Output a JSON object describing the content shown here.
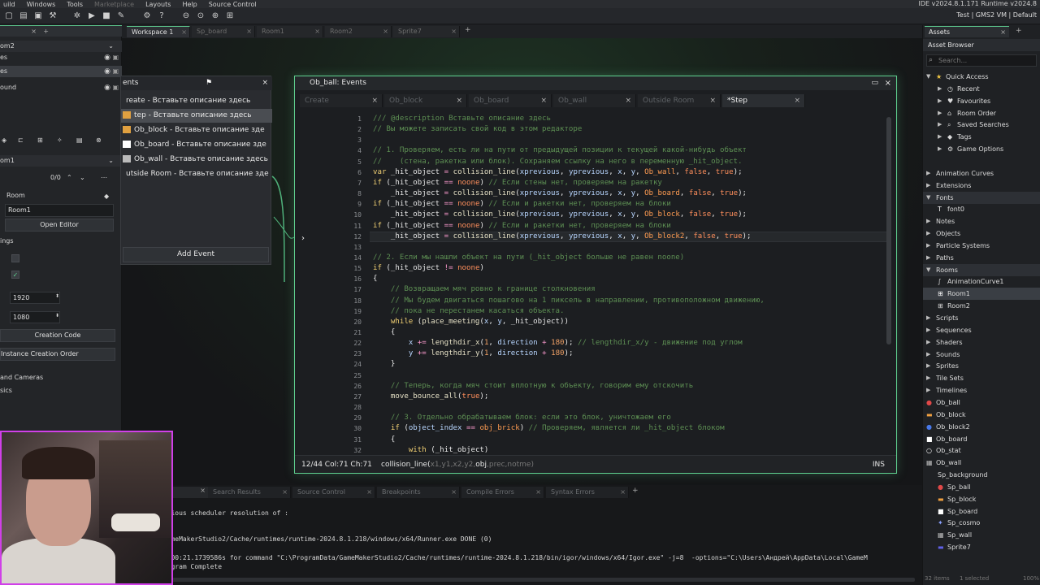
{
  "menu": {
    "items": [
      "uild",
      "Windows",
      "Tools",
      "Marketplace",
      "Layouts",
      "Help",
      "Source Control"
    ],
    "ide_info": "IDE v2024.8.1.171  Runtime v2024.8",
    "vm_info": "Test | GMS2 VM | Default"
  },
  "workspace_tabs": [
    {
      "label": "Workspace 1",
      "active": true
    },
    {
      "label": "Sp_board",
      "active": false
    },
    {
      "label": "Room1",
      "active": false
    },
    {
      "label": "Room2",
      "active": false
    },
    {
      "label": "Sprite7",
      "active": false
    }
  ],
  "left_panel": {
    "room_select": "om2",
    "layers": [
      "es",
      "es",
      "ound"
    ],
    "room_name_select": "om1",
    "counter": "0/0",
    "room_label": "Room",
    "room_field": "Room1",
    "open_editor": "Open Editor",
    "settings_label": "ings",
    "width": "1920",
    "height": "1080",
    "creation_code": "Creation Code",
    "instance_order": "Instance Creation Order",
    "cameras": "and Cameras",
    "physics": "sics"
  },
  "events_window": {
    "title": "ents",
    "items": [
      {
        "label": "reate - Вставьте описание здесь",
        "selected": false,
        "icon": ""
      },
      {
        "label": "tep - Вставьте описание здесь",
        "selected": true,
        "icon": "#e0a040"
      },
      {
        "label": "Ob_block - Вставьте описание зде",
        "selected": false,
        "icon": "#e0a040"
      },
      {
        "label": "Ob_board - Вставьте описание зде",
        "selected": false,
        "icon": "#ffffff"
      },
      {
        "label": "Ob_wall - Вставьте описание здесь",
        "selected": false,
        "icon": "#bbbbbb"
      },
      {
        "label": "utside Room - Вставьте описание зде",
        "selected": false,
        "icon": ""
      }
    ],
    "add_event": "Add Event"
  },
  "code_window": {
    "title": "Ob_ball: Events",
    "tabs": [
      {
        "label": "Create",
        "active": false
      },
      {
        "label": "Ob_block",
        "active": false
      },
      {
        "label": "Ob_board",
        "active": false
      },
      {
        "label": "Ob_wall",
        "active": false
      },
      {
        "label": "Outside Room",
        "active": false
      },
      {
        "label": "*Step",
        "active": true
      }
    ],
    "status_pos": "12/44 Col:71 Ch:71",
    "status_sig_fn": "collision_line(",
    "status_sig_args_pre": "x1,y1,x2,y2,",
    "status_sig_arg_cur": "obj",
    "status_sig_args_post": ",prec,notme)",
    "status_mode": "INS",
    "warning_line": 30,
    "current_line": 12
  },
  "code_lines": [
    {
      "n": 1,
      "t": "/// @description Вставьте описание здесь"
    },
    {
      "n": 2,
      "t": "// Вы можете записать свой код в этом редакторе"
    },
    {
      "n": 3,
      "t": ""
    },
    {
      "n": 4,
      "t": "// 1. Проверяем, есть ли на пути от предыдущей позиции к текущей какой-нибудь объект"
    },
    {
      "n": 5,
      "t": "//    (стена, ракетка или блок). Сохраняем ссылку на него в переменную _hit_object."
    },
    {
      "n": 6,
      "t": "var _hit_object = collision_line(xprevious, yprevious, x, y, Ob_wall, false, true);"
    },
    {
      "n": 7,
      "t": "if (_hit_object == noone) // Если стены нет, проверяем на ракетку"
    },
    {
      "n": 8,
      "t": "    _hit_object = collision_line(xprevious, yprevious, x, y, Ob_board, false, true);"
    },
    {
      "n": 9,
      "t": "if (_hit_object == noone) // Если и ракетки нет, проверяем на блоки"
    },
    {
      "n": 10,
      "t": "    _hit_object = collision_line(xprevious, yprevious, x, y, Ob_block, false, true);"
    },
    {
      "n": 11,
      "t": "if (_hit_object == noone) // Если и ракетки нет, проверяем на блоки"
    },
    {
      "n": 12,
      "t": "    _hit_object = collision_line(xprevious, yprevious, x, y, Ob_block2, false, true);"
    },
    {
      "n": 13,
      "t": ""
    },
    {
      "n": 14,
      "t": "// 2. Если мы нашли объект на пути (_hit_object больше не равен noone)"
    },
    {
      "n": 15,
      "t": "if (_hit_object != noone)"
    },
    {
      "n": 16,
      "t": "{"
    },
    {
      "n": 17,
      "t": "    // Возвращаем мяч ровно к границе столкновения"
    },
    {
      "n": 18,
      "t": "    // Мы будем двигаться пошагово на 1 пиксель в направлении, противоположном движению,"
    },
    {
      "n": 19,
      "t": "    // пока не перестанем касаться объекта."
    },
    {
      "n": 20,
      "t": "    while (place_meeting(x, y, _hit_object))"
    },
    {
      "n": 21,
      "t": "    {"
    },
    {
      "n": 22,
      "t": "        x += lengthdir_x(1, direction + 180); // lengthdir_x/y - движение под углом"
    },
    {
      "n": 23,
      "t": "        y += lengthdir_y(1, direction + 180);"
    },
    {
      "n": 24,
      "t": "    }"
    },
    {
      "n": 25,
      "t": ""
    },
    {
      "n": 26,
      "t": "    // Теперь, когда мяч стоит вплотную к объекту, говорим ему отскочить"
    },
    {
      "n": 27,
      "t": "    move_bounce_all(true);"
    },
    {
      "n": 28,
      "t": ""
    },
    {
      "n": 29,
      "t": "    // 3. Отдельно обрабатываем блок: если это блок, уничтожаем его"
    },
    {
      "n": 30,
      "t": "    if (object_index == obj_brick) // Проверяем, является ли _hit_object блоком"
    },
    {
      "n": 31,
      "t": "    {"
    },
    {
      "n": 32,
      "t": "        with (_hit_object)"
    }
  ],
  "assets": {
    "tab": "Assets",
    "browser": "Asset Browser",
    "search_placeholder": "Search...",
    "rows": [
      {
        "label": "Quick Access",
        "depth": 0,
        "arrow": "▼",
        "icon": "★",
        "iconColor": "#f2c744"
      },
      {
        "label": "Recent",
        "depth": 1,
        "arrow": "▶",
        "icon": "◷",
        "iconColor": "#dcdcdc"
      },
      {
        "label": "Favourites",
        "depth": 1,
        "arrow": "▶",
        "icon": "♥",
        "iconColor": "#dcdcdc"
      },
      {
        "label": "Room Order",
        "depth": 1,
        "arrow": "▶",
        "icon": "⌂",
        "iconColor": "#dcdcdc"
      },
      {
        "label": "Saved Searches",
        "depth": 1,
        "arrow": "▶",
        "icon": "⌕",
        "iconColor": "#dcdcdc"
      },
      {
        "label": "Tags",
        "depth": 1,
        "arrow": "▶",
        "icon": "◆",
        "iconColor": "#dcdcdc"
      },
      {
        "label": "Game Options",
        "depth": 1,
        "arrow": "▶",
        "icon": "⚙",
        "iconColor": "#dcdcdc"
      },
      {
        "label": "",
        "depth": 0,
        "arrow": "",
        "icon": "",
        "iconColor": ""
      },
      {
        "label": "Animation Curves",
        "depth": 0,
        "arrow": "▶",
        "icon": "",
        "iconColor": ""
      },
      {
        "label": "Extensions",
        "depth": 0,
        "arrow": "▶",
        "icon": "",
        "iconColor": ""
      },
      {
        "label": "Fonts",
        "depth": 0,
        "arrow": "▼",
        "icon": "",
        "iconColor": "",
        "hl": true
      },
      {
        "label": "font0",
        "depth": 1,
        "arrow": "",
        "icon": "T",
        "iconColor": "#ffffff"
      },
      {
        "label": "Notes",
        "depth": 0,
        "arrow": "▶",
        "icon": "",
        "iconColor": ""
      },
      {
        "label": "Objects",
        "depth": 0,
        "arrow": "▶",
        "icon": "",
        "iconColor": ""
      },
      {
        "label": "Particle Systems",
        "depth": 0,
        "arrow": "▶",
        "icon": "",
        "iconColor": ""
      },
      {
        "label": "Paths",
        "depth": 0,
        "arrow": "▶",
        "icon": "",
        "iconColor": ""
      },
      {
        "label": "Rooms",
        "depth": 0,
        "arrow": "▼",
        "icon": "",
        "iconColor": "",
        "hl": true
      },
      {
        "label": "AnimationCurve1",
        "depth": 1,
        "arrow": "",
        "icon": "∫",
        "iconColor": "#dcdcdc"
      },
      {
        "label": "Room1",
        "depth": 1,
        "arrow": "",
        "icon": "⊞",
        "iconColor": "#ffffff",
        "sel": true
      },
      {
        "label": "Room2",
        "depth": 1,
        "arrow": "",
        "icon": "⊞",
        "iconColor": "#dcdcdc"
      },
      {
        "label": "Scripts",
        "depth": 0,
        "arrow": "▶",
        "icon": "",
        "iconColor": ""
      },
      {
        "label": "Sequences",
        "depth": 0,
        "arrow": "▶",
        "icon": "",
        "iconColor": ""
      },
      {
        "label": "Shaders",
        "depth": 0,
        "arrow": "▶",
        "icon": "",
        "iconColor": ""
      },
      {
        "label": "Sounds",
        "depth": 0,
        "arrow": "▶",
        "icon": "",
        "iconColor": ""
      },
      {
        "label": "Sprites",
        "depth": 0,
        "arrow": "▶",
        "icon": "",
        "iconColor": ""
      },
      {
        "label": "Tile Sets",
        "depth": 0,
        "arrow": "▶",
        "icon": "",
        "iconColor": ""
      },
      {
        "label": "Timelines",
        "depth": 0,
        "arrow": "▶",
        "icon": "",
        "iconColor": ""
      },
      {
        "label": "Ob_ball",
        "depth": 0,
        "arrow": "",
        "icon": "●",
        "iconColor": "#e04848"
      },
      {
        "label": "Ob_block",
        "depth": 0,
        "arrow": "",
        "icon": "▬",
        "iconColor": "#f0a040"
      },
      {
        "label": "Ob_block2",
        "depth": 0,
        "arrow": "",
        "icon": "●",
        "iconColor": "#4878e8"
      },
      {
        "label": "Ob_board",
        "depth": 0,
        "arrow": "",
        "icon": "■",
        "iconColor": "#ffffff"
      },
      {
        "label": "Ob_stat",
        "depth": 0,
        "arrow": "",
        "icon": "○",
        "iconColor": "#ffffff"
      },
      {
        "label": "Ob_wall",
        "depth": 0,
        "arrow": "",
        "icon": "▦",
        "iconColor": "#bbbbbb"
      },
      {
        "label": "Sp_background",
        "depth": 1,
        "arrow": "",
        "icon": "",
        "iconColor": ""
      },
      {
        "label": "Sp_ball",
        "depth": 1,
        "arrow": "",
        "icon": "●",
        "iconColor": "#e04848"
      },
      {
        "label": "Sp_block",
        "depth": 1,
        "arrow": "",
        "icon": "▬",
        "iconColor": "#f0a040"
      },
      {
        "label": "Sp_board",
        "depth": 1,
        "arrow": "",
        "icon": "■",
        "iconColor": "#ffffff"
      },
      {
        "label": "Sp_cosmo",
        "depth": 1,
        "arrow": "",
        "icon": "✦",
        "iconColor": "#8aa0ff"
      },
      {
        "label": "Sp_wall",
        "depth": 1,
        "arrow": "",
        "icon": "▦",
        "iconColor": "#bbbbbb"
      },
      {
        "label": "Sprite7",
        "depth": 1,
        "arrow": "",
        "icon": "▬",
        "iconColor": "#6060e8"
      }
    ],
    "footer_items": "32 items",
    "footer_selected": "1 selected",
    "footer_zoom": "100%"
  },
  "output": {
    "tabs": [
      "Search Results",
      "Source Control",
      "Breakpoints",
      "Compile Errors",
      "Syntax Errors"
    ],
    "lines": [
      "revious scheduler resolution of :",
      "",
      "/GameMakerStudio2/Cache/runtimes/runtime-2024.8.1.218/windows/x64/Runner.exe DONE (0)",
      "",
      "00:00:21.1739586s for command \"C:\\ProgramData/GameMakerStudio2/Cache/runtimes/runtime-2024.8.1.218/bin/igor/windows/x64/Igor.exe\" -j=8  -options=\"C:\\Users\\Андрей\\AppData\\Local\\GameM",
      "Program Complete"
    ]
  },
  "colors": {
    "accent": "#5fd08f",
    "webcam_border": "#d040e8",
    "keyword": "#f1d073",
    "comment": "#5d8f53"
  }
}
